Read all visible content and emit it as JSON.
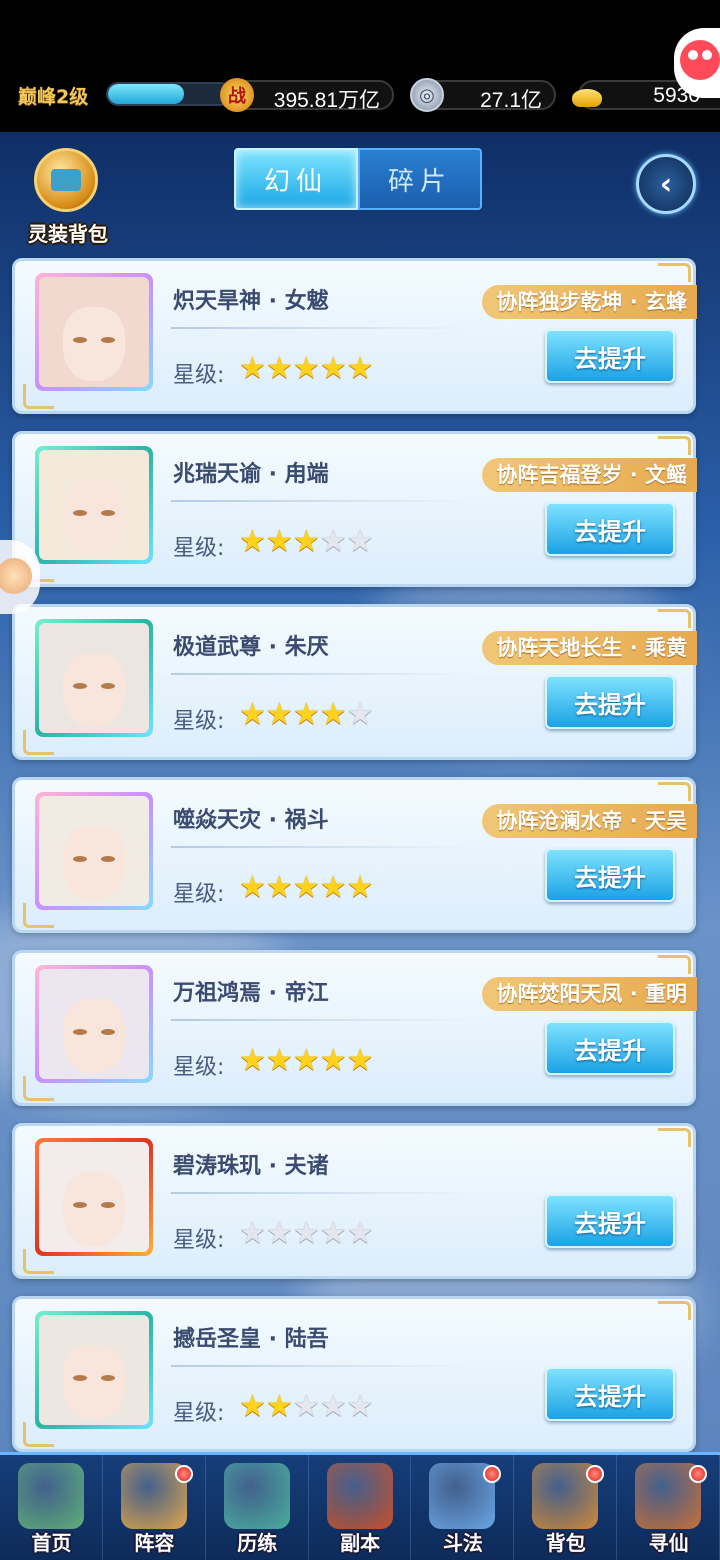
{
  "header": {
    "rank_label": "巅峰2级",
    "rank_progress": 0.62,
    "battle_power": "395.81万亿",
    "coins": "27.1亿",
    "gold": "5930"
  },
  "bag": {
    "label": "灵装背包"
  },
  "tabs": [
    {
      "label": "幻仙",
      "active": true
    },
    {
      "label": "碎片",
      "active": false
    }
  ],
  "star_label": "星级:",
  "upgrade_label": "去提升",
  "cards": [
    {
      "name": "炽天旱神 · 女魃",
      "stars": 5,
      "synergy": "协阵独步乾坤 · 玄蜂",
      "frame": "pink",
      "hair": "#f1d9cf"
    },
    {
      "name": "兆瑞天谕 · 甪端",
      "stars": 3,
      "synergy": "协阵吉福登岁 · 文鳐",
      "frame": "teal",
      "hair": "#f4eadb"
    },
    {
      "name": "极道武尊 · 朱厌",
      "stars": 4,
      "synergy": "协阵天地长生 · 乘黄",
      "frame": "teal",
      "hair": "#ece6e2"
    },
    {
      "name": "噬焱天灾 · 祸斗",
      "stars": 5,
      "synergy": "协阵沧澜水帝 · 天吴",
      "frame": "pink",
      "hair": "#f1ece3"
    },
    {
      "name": "万祖鸿焉 · 帝江",
      "stars": 5,
      "synergy": "协阵焚阳天凤 · 重明",
      "frame": "pink",
      "hair": "#ece7ee"
    },
    {
      "name": "碧涛珠玑 · 夫诸",
      "stars": 0,
      "synergy": "",
      "frame": "red",
      "hair": "#f3ecea"
    },
    {
      "name": "撼岳圣皇 · 陆吾",
      "stars": 2,
      "synergy": "",
      "frame": "teal",
      "hair": "#ece8e1"
    }
  ],
  "nav": [
    {
      "label": "首页",
      "icon": "home-icon",
      "badge": false,
      "color": "#5fb07a"
    },
    {
      "label": "阵容",
      "icon": "lineup-icon",
      "badge": true,
      "color": "#e0a64c"
    },
    {
      "label": "历练",
      "icon": "training-icon",
      "badge": false,
      "color": "#4ab0a0"
    },
    {
      "label": "副本",
      "icon": "dungeon-icon",
      "badge": false,
      "color": "#c8502a"
    },
    {
      "label": "斗法",
      "icon": "battle-icon",
      "badge": true,
      "color": "#6aa7e8"
    },
    {
      "label": "背包",
      "icon": "backpack-icon",
      "badge": true,
      "color": "#d08a3a"
    },
    {
      "label": "寻仙",
      "icon": "seek-immortal-icon",
      "badge": true,
      "color": "#c9703a"
    }
  ]
}
